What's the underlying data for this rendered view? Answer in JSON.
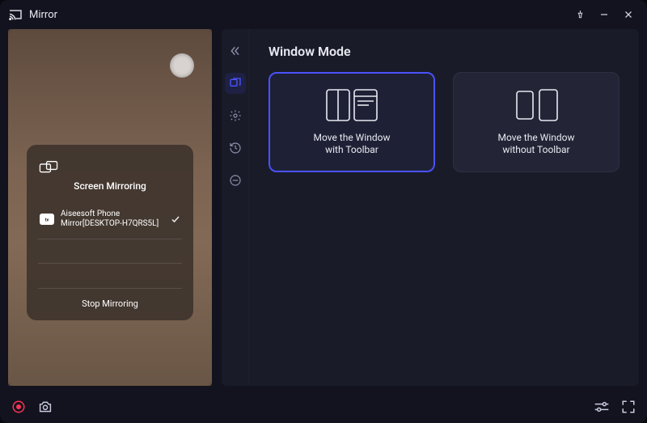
{
  "app": {
    "title": "Mirror"
  },
  "mirror_overlay": {
    "heading": "Screen Mirroring",
    "device_name": "Aiseesoft Phone Mirror[DESKTOP-H7QRS5L]",
    "device_badge": "▶TV",
    "stop_label": "Stop Mirroring"
  },
  "panel": {
    "heading": "Window Mode",
    "options": [
      {
        "title_line1": "Move the Window",
        "title_line2": "with Toolbar",
        "selected": true
      },
      {
        "title_line1": "Move the Window",
        "title_line2": "without Toolbar",
        "selected": false
      }
    ]
  }
}
